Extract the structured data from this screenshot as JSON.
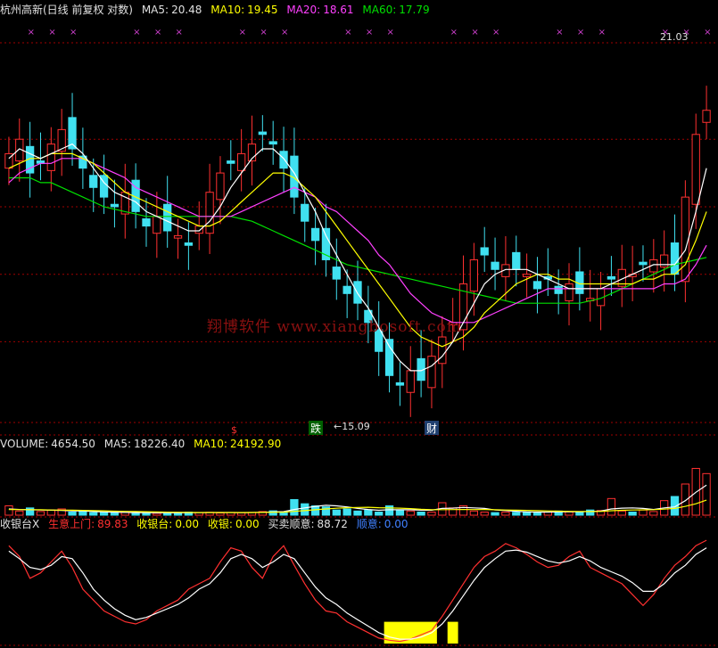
{
  "main_header": {
    "title": "杭州高新(日线 前复权 对数)",
    "ma5_label": "MA5:",
    "ma5_value": "20.48",
    "ma10_label": "MA10:",
    "ma10_value": "19.45",
    "ma20_label": "MA20:",
    "ma20_value": "18.61",
    "ma60_label": "MA60:",
    "ma60_value": "17.79"
  },
  "annotations": {
    "high_price": "21.03",
    "low_price": "←15.09",
    "marker_die": "跌",
    "marker_cai": "财",
    "marker_dollar": "$"
  },
  "volume_header": {
    "title": "VOLUME:",
    "value": "4654.50",
    "ma5_label": "MA5:",
    "ma5_value": "18226.40",
    "ma10_label": "MA10:",
    "ma10_value": "24192.90"
  },
  "indicator_header": {
    "title": "收银台X",
    "line1_label": "生意上门:",
    "line1_value": "89.83",
    "line2_label": "收银台:",
    "line2_value": "0.00",
    "line3_label": "收银:",
    "line3_value": "0.00",
    "line4_label": "买卖顺意:",
    "line4_value": "88.72",
    "line5_label": "顺意:",
    "line5_value": "0.00"
  },
  "watermark": "翔博软件 www.xiangbosoft.com",
  "colors": {
    "up": "#ff3030",
    "down": "#40e0f0",
    "ma5": "#ffffff",
    "ma10": "#ffff00",
    "ma20": "#ff40ff",
    "ma60": "#00e000",
    "grid": "#a00000",
    "signal": "#ffff00"
  },
  "chart_data": {
    "type": "candlestick",
    "ylim": [
      14.6,
      22.4
    ],
    "close_series": [
      20.1,
      20.4,
      19.7,
      19.9,
      20.3,
      20.6,
      20.2,
      19.8,
      19.4,
      19.2,
      19.0,
      19.3,
      18.9,
      18.6,
      18.8,
      18.5,
      18.4,
      18.2,
      18.6,
      19.3,
      19.7,
      19.9,
      20.1,
      20.3,
      20.5,
      20.3,
      19.8,
      19.2,
      18.7,
      18.3,
      17.9,
      17.5,
      17.2,
      17.0,
      16.6,
      16.0,
      15.5,
      15.3,
      15.6,
      15.4,
      15.9,
      16.3,
      16.6,
      17.4,
      17.9,
      18.0,
      17.7,
      17.8,
      17.7,
      17.6,
      17.3,
      17.5,
      17.2,
      17.4,
      17.2,
      17.1,
      17.3,
      17.5,
      17.7,
      17.6,
      17.8,
      17.9,
      18.0,
      17.6,
      19.2,
      20.5,
      21.0
    ],
    "ma5": [
      20.0,
      20.2,
      20.1,
      20.0,
      20.1,
      20.2,
      20.3,
      20.1,
      19.8,
      19.5,
      19.3,
      19.2,
      19.1,
      18.9,
      18.8,
      18.7,
      18.6,
      18.5,
      18.5,
      18.7,
      19.0,
      19.4,
      19.7,
      20.0,
      20.2,
      20.2,
      20.0,
      19.7,
      19.3,
      18.9,
      18.4,
      18.0,
      17.6,
      17.2,
      16.9,
      16.5,
      16.1,
      15.8,
      15.6,
      15.6,
      15.7,
      15.9,
      16.2,
      16.6,
      17.0,
      17.4,
      17.6,
      17.7,
      17.7,
      17.7,
      17.6,
      17.5,
      17.4,
      17.3,
      17.3,
      17.3,
      17.3,
      17.4,
      17.5,
      17.6,
      17.7,
      17.8,
      17.8,
      17.8,
      18.1,
      18.9,
      19.8
    ],
    "ma10": [
      19.8,
      19.9,
      20.0,
      20.0,
      20.1,
      20.1,
      20.1,
      20.0,
      19.9,
      19.7,
      19.5,
      19.3,
      19.2,
      19.1,
      19.0,
      18.9,
      18.8,
      18.7,
      18.6,
      18.6,
      18.7,
      18.9,
      19.1,
      19.3,
      19.5,
      19.7,
      19.7,
      19.6,
      19.4,
      19.2,
      18.9,
      18.6,
      18.3,
      18.0,
      17.7,
      17.4,
      17.1,
      16.8,
      16.5,
      16.3,
      16.2,
      16.1,
      16.2,
      16.3,
      16.5,
      16.8,
      17.0,
      17.2,
      17.4,
      17.5,
      17.6,
      17.6,
      17.5,
      17.5,
      17.4,
      17.4,
      17.4,
      17.4,
      17.4,
      17.4,
      17.5,
      17.5,
      17.6,
      17.6,
      17.8,
      18.3,
      18.9
    ],
    "ma20": [
      19.5,
      19.7,
      19.8,
      19.9,
      19.9,
      20.0,
      20.0,
      20.0,
      19.9,
      19.8,
      19.7,
      19.6,
      19.4,
      19.3,
      19.2,
      19.1,
      19.0,
      18.9,
      18.8,
      18.8,
      18.8,
      18.8,
      18.9,
      19.0,
      19.1,
      19.2,
      19.3,
      19.4,
      19.3,
      19.2,
      19.0,
      18.9,
      18.7,
      18.5,
      18.3,
      18.0,
      17.8,
      17.5,
      17.2,
      17.0,
      16.8,
      16.7,
      16.6,
      16.6,
      16.6,
      16.7,
      16.8,
      16.9,
      17.0,
      17.1,
      17.2,
      17.3,
      17.3,
      17.3,
      17.3,
      17.3,
      17.3,
      17.3,
      17.3,
      17.3,
      17.3,
      17.3,
      17.4,
      17.4,
      17.5,
      17.8,
      18.2
    ],
    "ma60": [
      19.6,
      19.6,
      19.6,
      19.5,
      19.5,
      19.4,
      19.3,
      19.2,
      19.1,
      19.0,
      18.95,
      18.9,
      18.85,
      18.8,
      18.8,
      18.8,
      18.8,
      18.8,
      18.8,
      18.8,
      18.8,
      18.8,
      18.75,
      18.7,
      18.6,
      18.5,
      18.4,
      18.3,
      18.2,
      18.1,
      18.0,
      17.9,
      17.8,
      17.75,
      17.7,
      17.65,
      17.6,
      17.55,
      17.5,
      17.45,
      17.4,
      17.35,
      17.3,
      17.25,
      17.2,
      17.15,
      17.1,
      17.05,
      17.0,
      17.0,
      17.0,
      17.0,
      17.0,
      17.0,
      17.0,
      17.05,
      17.1,
      17.2,
      17.3,
      17.4,
      17.5,
      17.6,
      17.7,
      17.8,
      17.85,
      17.9,
      17.95
    ],
    "volume": {
      "ylim": [
        0,
        60000
      ],
      "values": [
        9000,
        4000,
        7000,
        3500,
        5000,
        6000,
        3000,
        4000,
        2500,
        3000,
        2200,
        2600,
        2000,
        2400,
        1800,
        2500,
        2200,
        3000,
        2600,
        2800,
        2100,
        2600,
        2400,
        2700,
        3500,
        4200,
        3200,
        15000,
        11000,
        9000,
        8000,
        5000,
        6000,
        4000,
        5000,
        3000,
        9000,
        5000,
        4000,
        3000,
        3000,
        12000,
        7000,
        9000,
        4000,
        3000,
        2500,
        3000,
        2800,
        3200,
        2800,
        3000,
        4000,
        3200,
        3000,
        5000,
        4500,
        16000,
        4000,
        3000,
        5000,
        3500,
        14000,
        18000,
        30000,
        45000,
        40000
      ],
      "ma5": [
        6000,
        5500,
        5200,
        5000,
        4800,
        4600,
        4200,
        4000,
        3500,
        3200,
        2900,
        2700,
        2500,
        2400,
        2300,
        2300,
        2300,
        2400,
        2500,
        2600,
        2600,
        2600,
        2500,
        2600,
        2800,
        3100,
        3400,
        5500,
        7000,
        8500,
        9500,
        9000,
        8000,
        6500,
        5500,
        4700,
        5300,
        5200,
        5200,
        4800,
        4800,
        6500,
        6800,
        7500,
        7000,
        6500,
        5000,
        4500,
        3800,
        3200,
        3000,
        3000,
        3200,
        3300,
        3300,
        3600,
        4000,
        6000,
        6800,
        7000,
        6500,
        5500,
        7000,
        8000,
        14000,
        22000,
        29000
      ],
      "ma10": [
        5500,
        5400,
        5300,
        5200,
        5000,
        4900,
        4800,
        4600,
        4400,
        4200,
        3900,
        3700,
        3500,
        3300,
        3100,
        2900,
        2800,
        2700,
        2600,
        2600,
        2600,
        2600,
        2600,
        2600,
        2700,
        2800,
        2900,
        3700,
        4400,
        5200,
        6000,
        6700,
        7200,
        7500,
        7600,
        7200,
        7000,
        6800,
        6300,
        5700,
        5300,
        5300,
        5400,
        5500,
        5400,
        5500,
        5200,
        5000,
        4800,
        4600,
        4400,
        4100,
        3900,
        3700,
        3600,
        3500,
        3600,
        4300,
        4700,
        5000,
        5100,
        5300,
        5800,
        6500,
        8500,
        11000,
        14500
      ]
    },
    "indicator": {
      "ylim": [
        0,
        100
      ],
      "line_red": [
        90,
        80,
        60,
        65,
        75,
        85,
        70,
        50,
        40,
        30,
        25,
        20,
        18,
        22,
        30,
        35,
        40,
        50,
        55,
        60,
        75,
        88,
        85,
        70,
        60,
        80,
        90,
        72,
        55,
        40,
        30,
        28,
        20,
        15,
        10,
        5,
        3,
        2,
        4,
        8,
        12,
        25,
        40,
        55,
        70,
        80,
        85,
        92,
        88,
        82,
        75,
        70,
        72,
        80,
        85,
        70,
        65,
        60,
        55,
        45,
        35,
        45,
        60,
        72,
        80,
        90,
        95
      ],
      "line_white": [
        85,
        78,
        70,
        68,
        72,
        80,
        78,
        65,
        50,
        40,
        32,
        26,
        22,
        24,
        28,
        32,
        36,
        42,
        50,
        55,
        65,
        78,
        82,
        78,
        70,
        75,
        82,
        78,
        65,
        52,
        42,
        36,
        28,
        22,
        16,
        10,
        6,
        4,
        4,
        6,
        10,
        18,
        30,
        44,
        58,
        70,
        78,
        85,
        86,
        84,
        80,
        76,
        74,
        76,
        80,
        76,
        70,
        66,
        62,
        56,
        48,
        48,
        55,
        65,
        72,
        82,
        88
      ],
      "signal_bars": [
        {
          "from": 36,
          "to": 40,
          "value": 20
        },
        {
          "from": 42,
          "to": 42,
          "value": 20
        }
      ]
    }
  }
}
